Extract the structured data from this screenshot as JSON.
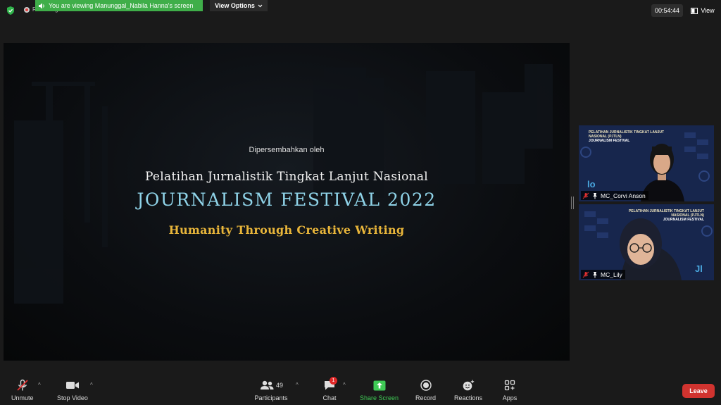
{
  "topbar": {
    "recording_label": "Recording",
    "viewing_text": "You are viewing Manunggal_Nabila Hanna's screen",
    "view_options_label": "View Options",
    "timer": "00:54:44",
    "view_label": "View"
  },
  "slide": {
    "presented_by": "Dipersembahkan oleh",
    "title_line1": "Pelatihan Jurnalistik Tingkat Lanjut  Nasional",
    "title_line2": "JOURNALISM FESTIVAL 2022",
    "tagline": "Humanity Through Creative Writing"
  },
  "participants_tiles": [
    {
      "name": "MC_Corvi Anson",
      "banner_line1": "PELATIHAN JURNALISTIK TINGKAT LANJUT",
      "banner_line2": "NASIONAL (PJTLN)",
      "banner_line3": "JOURNALISM FESTIVAL"
    },
    {
      "name": "MC_Lily",
      "banner_line1": "PELATIHAN JURNALISTIK TINGKAT LANJUT",
      "banner_line2": "NASIONAL (PJTLN)",
      "banner_line3": "JOURNALISM FESTIVAL"
    }
  ],
  "toolbar": {
    "unmute_label": "Unmute",
    "stop_video_label": "Stop Video",
    "participants_label": "Participants",
    "participants_count": "49",
    "chat_label": "Chat",
    "chat_badge": "1",
    "share_screen_label": "Share Screen",
    "record_label": "Record",
    "reactions_label": "Reactions",
    "apps_label": "Apps",
    "leave_label": "Leave"
  },
  "colors": {
    "viewing_banner": "#3fae49",
    "slide_title_blue": "#8fd3e8",
    "slide_tagline_gold": "#e8b53a",
    "leave_button": "#d0332f",
    "share_screen_green": "#3fca55"
  }
}
